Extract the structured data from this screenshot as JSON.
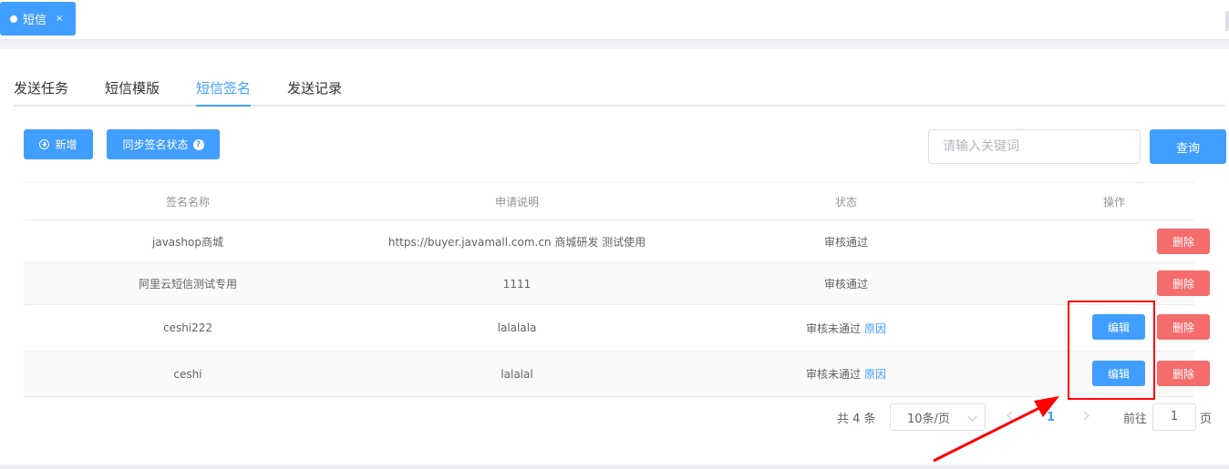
{
  "top_tab": {
    "label": "短信",
    "close": "×"
  },
  "sub_tabs": [
    {
      "label": "发送任务"
    },
    {
      "label": "短信模版"
    },
    {
      "label": "短信签名"
    },
    {
      "label": "发送记录"
    }
  ],
  "toolbar": {
    "add_label": "新增",
    "sync_label": "同步签名状态",
    "help_glyph": "?",
    "search_placeholder": "请输入关键词",
    "search_button": "查询"
  },
  "table": {
    "headers": [
      "签名名称",
      "申请说明",
      "状态",
      "操作"
    ],
    "rows": [
      {
        "name": "javashop商城",
        "desc": "https://buyer.javamall.com.cn 商城研发 测试使用",
        "status": "审核通过",
        "reason": "",
        "edit": "",
        "delete": "删除"
      },
      {
        "name": "阿里云短信测试专用",
        "desc": "1111",
        "status": "审核通过",
        "reason": "",
        "edit": "",
        "delete": "删除"
      },
      {
        "name": "ceshi222",
        "desc": "lalalala",
        "status": "审核未通过",
        "reason": "原因",
        "edit": "编辑",
        "delete": "删除"
      },
      {
        "name": "ceshi",
        "desc": "lalalal",
        "status": "审核未通过",
        "reason": "原因",
        "edit": "编辑",
        "delete": "删除"
      }
    ]
  },
  "pagination": {
    "total_text": "共 4 条",
    "page_size": "10条/页",
    "current_page": "1",
    "goto_label": "前往",
    "goto_value": "1",
    "page_suffix": "页"
  },
  "colors": {
    "primary": "#409eff",
    "danger": "#f56c6c",
    "annotation": "#ff0000"
  }
}
